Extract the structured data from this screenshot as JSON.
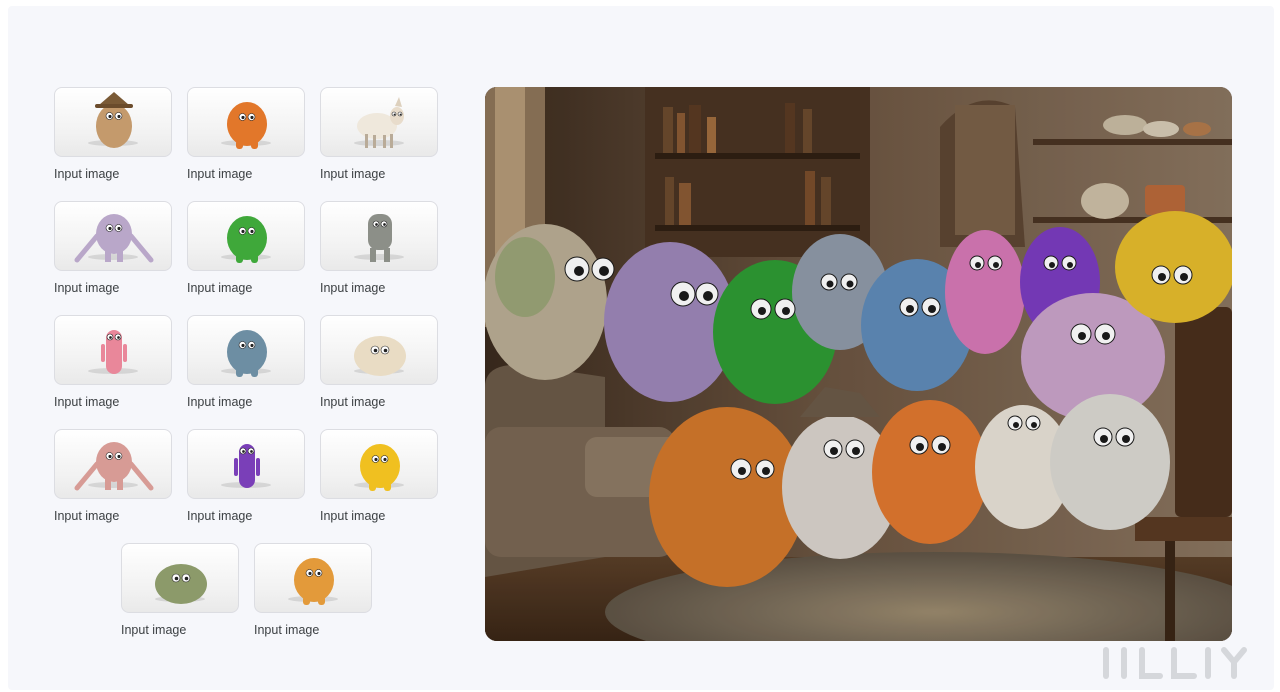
{
  "inputs": [
    {
      "label": "Input image",
      "icon": "monster-scarecrow-hat",
      "color": "#c49a6c"
    },
    {
      "label": "Input image",
      "icon": "monster-orange-fluffy",
      "color": "#e2772a"
    },
    {
      "label": "Input image",
      "icon": "sheep",
      "color": "#efe8dc"
    },
    {
      "label": "Input image",
      "icon": "monster-lavender-spotted",
      "color": "#b9a7c9"
    },
    {
      "label": "Input image",
      "icon": "monster-green-fluffy",
      "color": "#3fa83a"
    },
    {
      "label": "Input image",
      "icon": "monster-gray-tall",
      "color": "#8c8f88"
    },
    {
      "label": "Input image",
      "icon": "monster-pink-tall",
      "color": "#e9879a"
    },
    {
      "label": "Input image",
      "icon": "monster-blue-gray",
      "color": "#6d8ea3"
    },
    {
      "label": "Input image",
      "icon": "monster-cream-round",
      "color": "#e9dcc4"
    },
    {
      "label": "Input image",
      "icon": "monster-pink-long-arms",
      "color": "#d79b95"
    },
    {
      "label": "Input image",
      "icon": "monster-purple-slim",
      "color": "#7a3fb8"
    },
    {
      "label": "Input image",
      "icon": "monster-yellow-fluffy",
      "color": "#f0c020"
    },
    {
      "label": "Input image",
      "icon": "monster-mossy-green",
      "color": "#8c9a6a"
    },
    {
      "label": "Input image",
      "icon": "monster-orange-small",
      "color": "#e39a3a"
    }
  ],
  "output": {
    "icon": "monster-group-living-room-image"
  },
  "colors": {
    "panel": "#f6f7fb",
    "caption": "#3c4043",
    "thumb_border": "#dcdde2"
  }
}
